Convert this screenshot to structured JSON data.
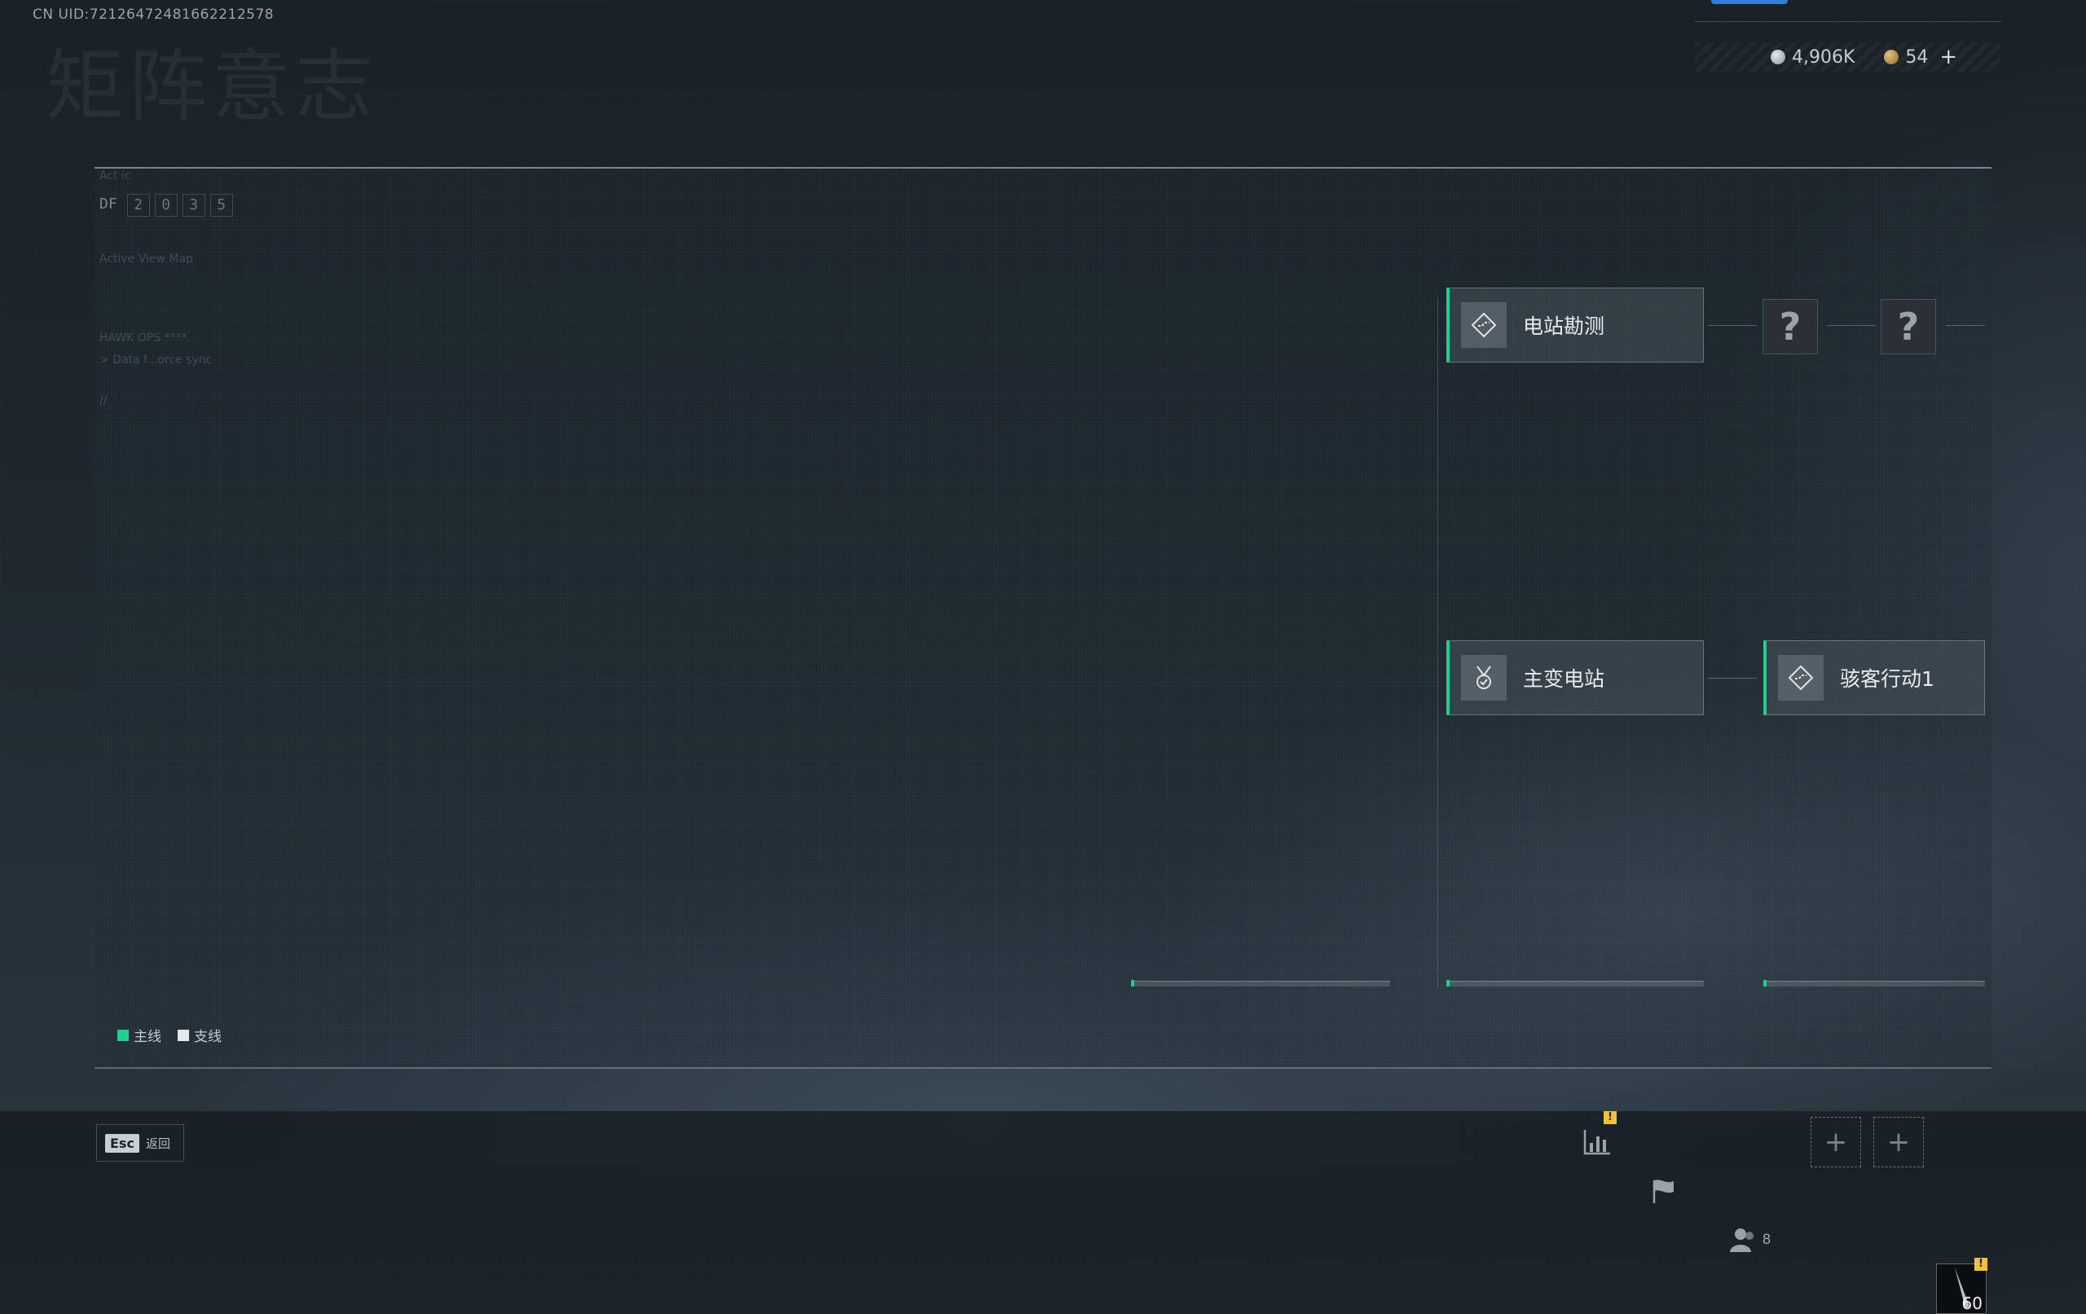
{
  "uid": "CN UID:72126472481662212578",
  "bg_title": "矩阵意志",
  "currency": {
    "silver_value": "4,906K",
    "gold_value": "54",
    "add_label": "+"
  },
  "panel": {
    "code_label": "DF",
    "code_digits": [
      "2",
      "0",
      "3",
      "5"
    ],
    "faint_lines": [
      "Act ic",
      "Active View Map",
      "HAWK OPS ****",
      "> Data f...orce sync",
      "//"
    ]
  },
  "nodes": {
    "station_survey": "电站勘测",
    "main_substation": "主变电站",
    "hacker_op": "骇客行动1",
    "unknown1": "?",
    "unknown2": "?"
  },
  "legend": {
    "main_label": "主线",
    "side_label": "支线",
    "main_color": "#19d38c",
    "side_color": "#e6e9ec"
  },
  "bottom": {
    "esc_key": "Esc",
    "esc_label": "返回",
    "warn_mark": "!",
    "friends_count": "8",
    "add_slot": "+",
    "weapon_count": "60"
  },
  "colors": {
    "accent_green": "#19d38c",
    "accent_blue": "#2f7fd8",
    "warning_yellow": "#f2c230"
  }
}
